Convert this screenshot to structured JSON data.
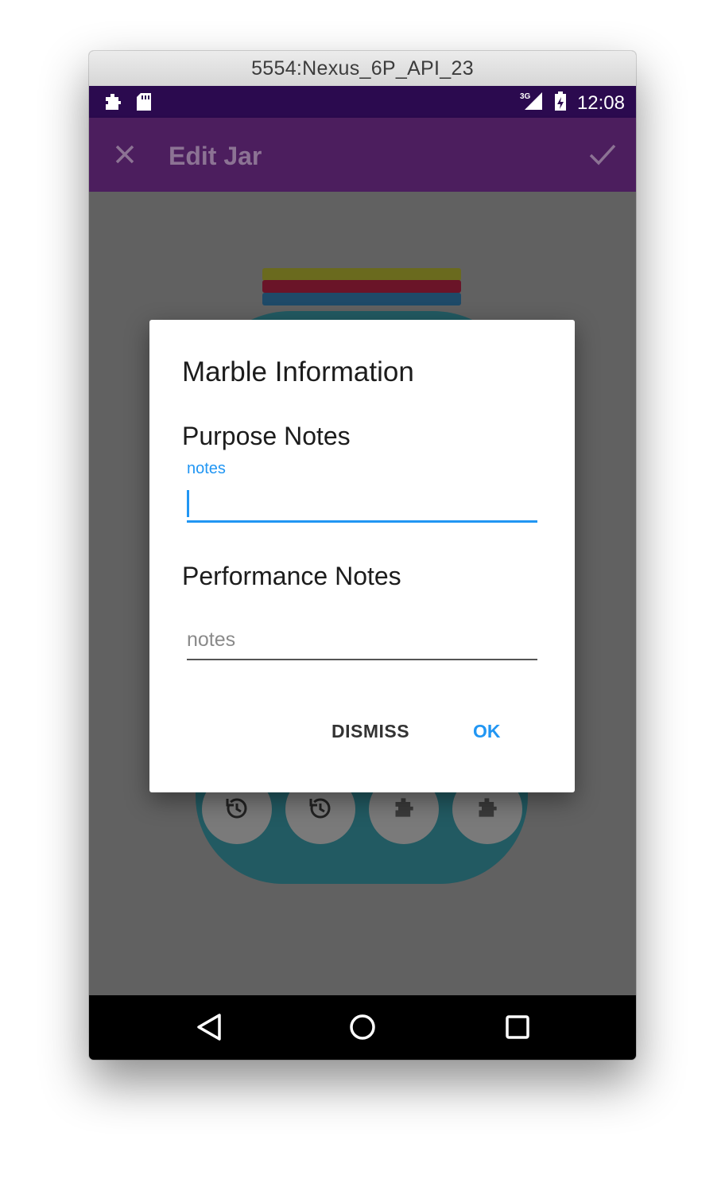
{
  "window": {
    "title": "5554:Nexus_6P_API_23"
  },
  "status_bar": {
    "time": "12:08",
    "network": "3G"
  },
  "app_bar": {
    "title": "Edit Jar"
  },
  "jar": {
    "lid_colors": [
      "#6a6a1e",
      "#6a1428",
      "#1e4a68"
    ],
    "body_color": "#225a62",
    "marbles": [
      {
        "icon": "history-icon"
      },
      {
        "icon": "history-icon"
      },
      {
        "icon": "puzzle-icon"
      },
      {
        "icon": "puzzle-icon"
      }
    ]
  },
  "dialog": {
    "title": "Marble Information",
    "purpose_section": "Purpose Notes",
    "purpose_label": "notes",
    "purpose_value": "",
    "performance_section": "Performance Notes",
    "performance_placeholder": "notes",
    "dismiss_label": "DISMISS",
    "ok_label": "OK"
  },
  "colors": {
    "accent": "#2196f3",
    "primary": "#4c1e5e",
    "status_bar": "#2b0a4f"
  }
}
